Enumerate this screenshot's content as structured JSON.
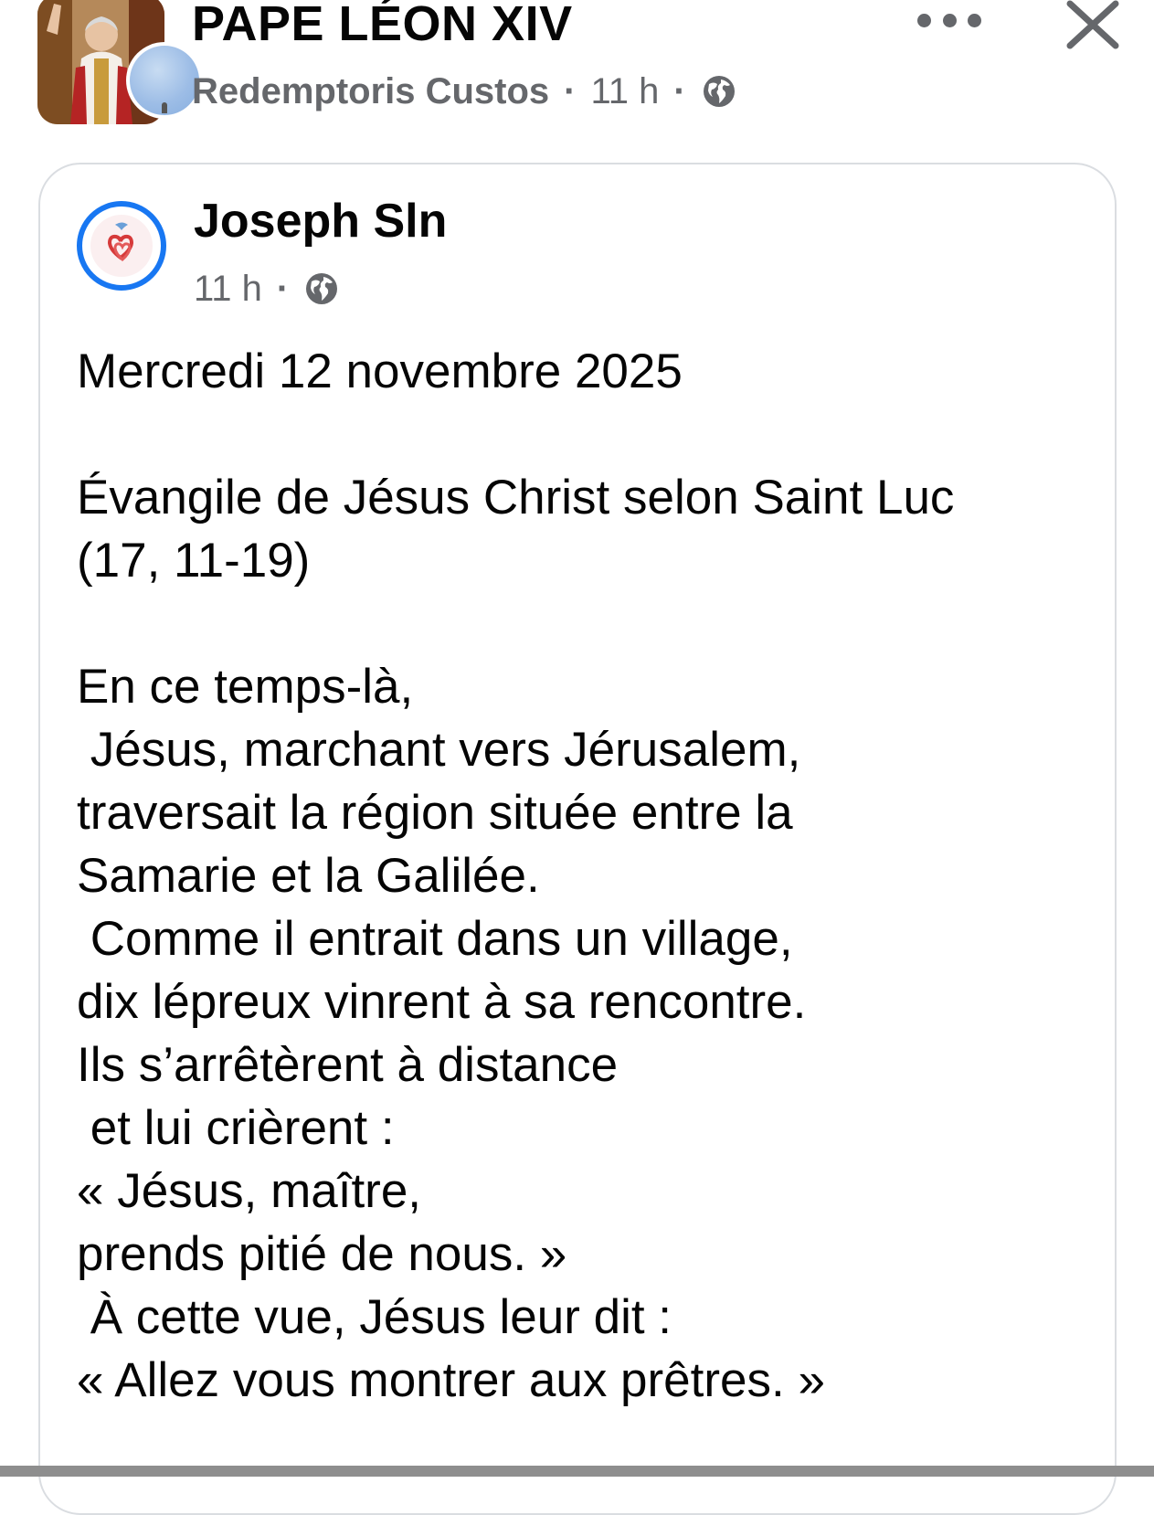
{
  "header": {
    "group_name": "PAPE LÉON XIV",
    "author": "Redemptoris Custos",
    "time": "11 h",
    "separator": "·",
    "audience_icon": "globe-icon",
    "more_icon": "more-horizontal-icon",
    "close_icon": "close-icon"
  },
  "shared_post": {
    "poster_name": "Joseph Sln",
    "time": "11 h",
    "separator": "·",
    "audience_icon": "globe-icon",
    "lines": [
      "Mercredi 12 novembre 2025",
      "",
      "Évangile de Jésus Christ selon Saint Luc",
      "(17, 11-19)",
      "",
      "En ce temps-là,",
      " Jésus, marchant vers Jérusalem,",
      "traversait la région située entre la",
      "Samarie et la Galilée.",
      " Comme il entrait dans un village,",
      "dix lépreux vinrent à sa rencontre.",
      "Ils s’arrêtèrent à distance",
      " et lui crièrent :",
      "« Jésus, maître,",
      "prends pitié de nous. »",
      " À cette vue, Jésus leur dit :",
      "« Allez vous montrer aux prêtres. »"
    ]
  },
  "colors": {
    "accent": "#1877f2",
    "secondary_text": "#65676b",
    "primary_text": "#050505",
    "card_border": "#dadde1"
  }
}
